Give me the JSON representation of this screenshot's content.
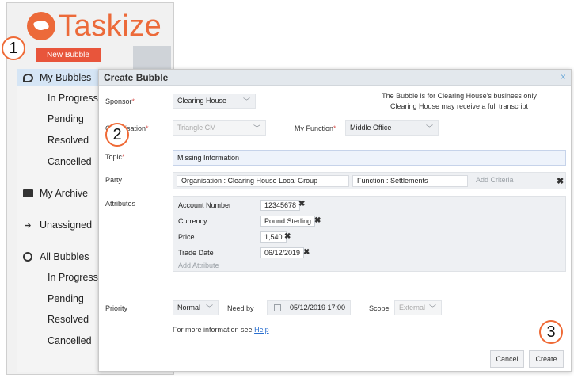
{
  "app": {
    "logo_text": "Taskize",
    "new_bubble_label": "New Bubble"
  },
  "sidebar": {
    "my_bubbles": "My Bubbles",
    "my_sub": [
      "In Progress",
      "Pending",
      "Resolved",
      "Cancelled"
    ],
    "my_archive": "My Archive",
    "unassigned": "Unassigned",
    "all_bubbles": "All Bubbles",
    "all_sub": [
      "In Progress",
      "Pending",
      "Resolved",
      "Cancelled"
    ]
  },
  "steps": [
    "1",
    "2",
    "3"
  ],
  "dialog": {
    "title": "Create Bubble",
    "close_icon": "×",
    "sponsor_label": "Sponsor",
    "sponsor_value": "Clearing House",
    "note_line1": "The Bubble is for Clearing House's business only",
    "note_line2": "Clearing House may receive a full transcript",
    "organisation_label": "Organisation",
    "organisation_value": "Triangle CM",
    "function_label": "My Function",
    "function_value": "Middle Office",
    "topic_label": "Topic",
    "topic_value": "Missing Information",
    "party_label": "Party",
    "party_org_tag": "Organisation :  Clearing House Local Group",
    "party_function_tag": "Function :  Settlements",
    "add_criteria": "Add Criteria",
    "attributes_label": "Attributes",
    "attributes": [
      {
        "name": "Account Number",
        "value": "12345678"
      },
      {
        "name": "Currency",
        "value": "Pound Sterling"
      },
      {
        "name": "Price",
        "value": "1,540"
      },
      {
        "name": "Trade Date",
        "value": "06/12/2019"
      }
    ],
    "add_attribute": "Add Attribute",
    "priority_label": "Priority",
    "priority_value": "Normal",
    "need_by_label": "Need by",
    "need_by_value": "05/12/2019 17:00",
    "scope_label": "Scope",
    "scope_value": "External",
    "help_text": "For more information see",
    "help_link": "Help",
    "cancel_label": "Cancel",
    "create_label": "Create",
    "required_mark": "*"
  },
  "colors": {
    "brand": "#ec6a3a",
    "step_ring": "#ef6a36",
    "active_nav": "#d5e5f5",
    "link": "#2a6fcf"
  }
}
